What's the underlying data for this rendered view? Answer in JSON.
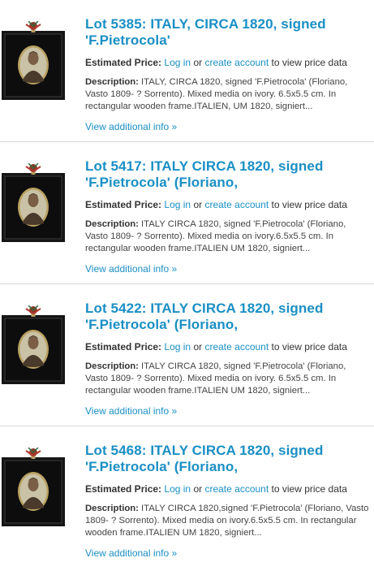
{
  "labels": {
    "estimated_price": "Estimated Price:",
    "log_in": "Log in",
    "or": "or",
    "create_account": "create account",
    "to_view": "to view price data",
    "description": "Description:",
    "view_more": "View additional info »"
  },
  "lots": [
    {
      "title_line1": "Lot 5385: ITALY, CIRCA 1820, signed",
      "title_line2": "'F.Pietrocola'",
      "description": "ITALY, CIRCA 1820, signed 'F.Pietrocola' (Floriano, Vasto 1809- ? Sorrento). Mixed media on ivory. 6.5x5.5 cm. In rectangular wooden frame.ITALIEN, UM 1820, signiert...",
      "thumbnail": "portrait-miniature-icon"
    },
    {
      "title_line1": "Lot 5417: ITALY CIRCA 1820, signed",
      "title_line2": "'F.Pietrocola' (Floriano,",
      "description": "ITALY CIRCA 1820, signed 'F.Pietrocola' (Floriano, Vasto 1809- ? Sorrento). Mixed media on ivory.6.5x5.5 cm. In rectangular wooden frame.ITALIEN UM 1820, signiert...",
      "thumbnail": "portrait-miniature-icon"
    },
    {
      "title_line1": "Lot 5422: ITALY CIRCA 1820, signed",
      "title_line2": "'F.Pietrocola' (Floriano,",
      "description": "ITALY CIRCA 1820, signed 'F.Pietrocola' (Floriano, Vasto 1809- ? Sorrento). Mixed media on ivory. 6.5x5.5 cm. In rectangular wooden frame.ITALIEN UM 1820, signiert...",
      "thumbnail": "portrait-miniature-icon"
    },
    {
      "title_line1": "Lot 5468: ITALY CIRCA 1820, signed",
      "title_line2": "'F.Pietrocola' (Floriano,",
      "description": "ITALY CIRCA 1820,signed 'F.Pietrocola' (Floriano, Vasto 1809- ? Sorrento). Mixed media on ivory.6.5x5.5 cm. In rectangular wooden frame.ITALIEN UM 1820, signiert...",
      "thumbnail": "portrait-miniature-icon"
    }
  ],
  "colors": {
    "link": "#1a8fc4",
    "divider": "#d6d6d6"
  }
}
